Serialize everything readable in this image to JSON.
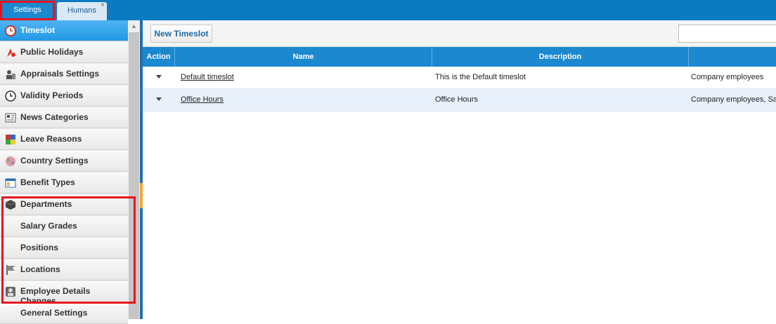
{
  "tabs": [
    {
      "label": "Settings"
    },
    {
      "label": "Humans",
      "close": "×"
    }
  ],
  "sidebar": {
    "items": [
      {
        "label": "Timeslot",
        "icon": "clock-red-icon",
        "active": true
      },
      {
        "label": "Public Holidays",
        "icon": "holiday-icon"
      },
      {
        "label": "Appraisals Settings",
        "icon": "appraisal-icon"
      },
      {
        "label": "Validity Periods",
        "icon": "clock-icon"
      },
      {
        "label": "News Categories",
        "icon": "news-icon"
      },
      {
        "label": "Leave Reasons",
        "icon": "leave-icon"
      },
      {
        "label": "Country Settings",
        "icon": "globe-icon"
      },
      {
        "label": "Benefit Types",
        "icon": "benefit-icon"
      },
      {
        "label": "Departments",
        "icon": "cube-icon"
      },
      {
        "label": "Salary Grades",
        "icon": ""
      },
      {
        "label": "Positions",
        "icon": ""
      },
      {
        "label": "Locations",
        "icon": "flag-icon"
      },
      {
        "label": "Employee Details Changes",
        "icon": "employee-icon"
      },
      {
        "label": "General Settings",
        "icon": ""
      }
    ]
  },
  "toolbar": {
    "new_label": "New Timeslot",
    "search_value": ""
  },
  "grid": {
    "columns": [
      "Action",
      "Name",
      "Description",
      ""
    ],
    "rows": [
      {
        "name": "Default timeslot",
        "description": "This is the Default timeslot",
        "extra": "Company employees"
      },
      {
        "name": "Office Hours",
        "description": "Office Hours",
        "extra": "Company employees, Sa"
      }
    ]
  },
  "colors": {
    "accent": "#1b88cf",
    "highlight": "#e8141b"
  }
}
